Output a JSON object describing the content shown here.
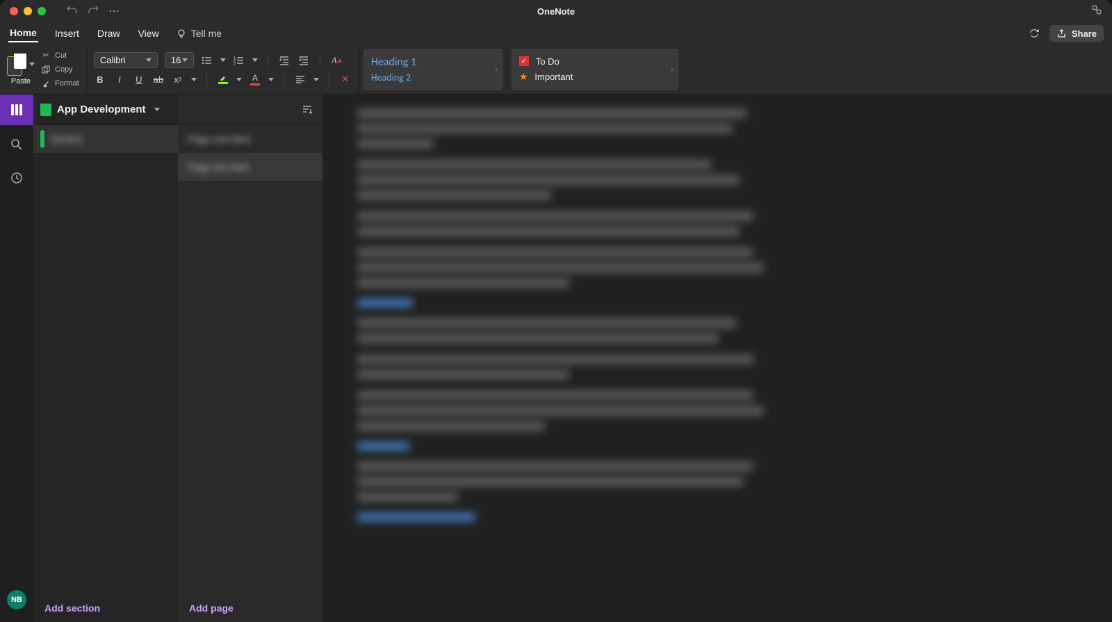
{
  "title": "OneNote",
  "menu": {
    "home": "Home",
    "insert": "Insert",
    "draw": "Draw",
    "view": "View",
    "tellme": "Tell me",
    "share": "Share"
  },
  "clipboard": {
    "paste": "Paste",
    "cut": "Cut",
    "copy": "Copy",
    "format": "Format"
  },
  "font": {
    "name": "Calibri",
    "size": "16"
  },
  "styles": {
    "h1": "Heading 1",
    "h2": "Heading 2"
  },
  "tags": {
    "todo": "To Do",
    "important": "Important"
  },
  "notebook": {
    "name": "App Development"
  },
  "section": {
    "redacted": "Section"
  },
  "pages": {
    "p1": "Page one item",
    "p2": "Page two item"
  },
  "actions": {
    "add_section": "Add section",
    "add_page": "Add page"
  },
  "avatar": "NB"
}
